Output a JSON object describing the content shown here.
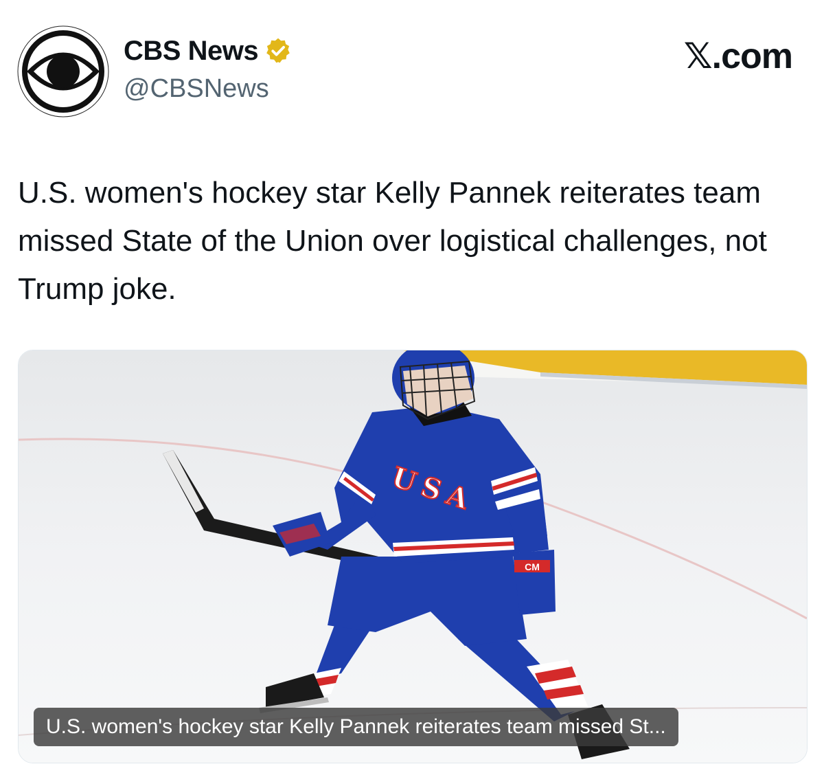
{
  "author": {
    "display_name": "CBS News",
    "handle": "@CBSNews",
    "verified_badge_icon": "verified-badge-icon",
    "verified_badge_color": "#e2b719",
    "avatar_logo": "cbs-eye-logo"
  },
  "site_brand": "𝕏.com",
  "post": {
    "text": "U.S. women's hockey star Kelly Pannek reiterates team missed State of the Union over logistical challenges, not Trump joke."
  },
  "media": {
    "caption": "U.S. women's hockey star Kelly Pannek reiterates team missed St...",
    "photo_subject": "hockey player in blue USA jersey skating on ice",
    "jersey_text": "USA",
    "glove_text": "CM"
  },
  "colors": {
    "text_primary": "#0f1419",
    "text_secondary": "#536471",
    "jersey_blue": "#1f3fae",
    "stripe_red": "#d42a2a",
    "ice": "#eef0f2",
    "boards_yellow": "#e9b927"
  }
}
